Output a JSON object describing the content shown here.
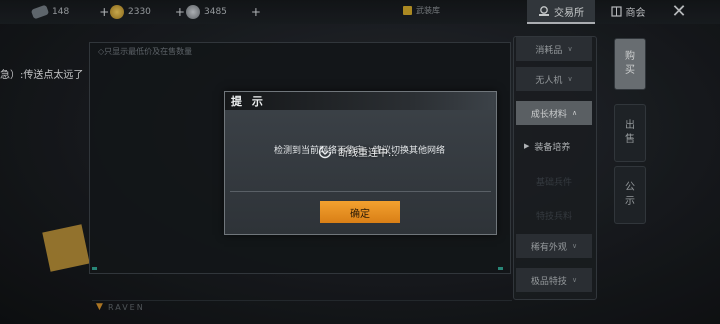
{
  "currencies": [
    {
      "icon": "fuel-icon",
      "value": "148"
    },
    {
      "icon": "gold-coin-icon",
      "value": "2330"
    },
    {
      "icon": "silver-coin-icon",
      "value": "3485"
    }
  ],
  "plus_label": "+",
  "warehouse_label": "武装库",
  "tabs": {
    "exchange": "交易所",
    "shop": "商会"
  },
  "close_glyph": "✕",
  "chat_message": "急）:传送点太远了",
  "panel_hint": "◇只显示最低价及在售数量",
  "categories": [
    {
      "label": "消耗品",
      "chevron": "∨"
    },
    {
      "label": "无人机",
      "chevron": "∨"
    },
    {
      "label": "成长材料",
      "chevron": "∧",
      "active": true
    }
  ],
  "subcategories": [
    "装备培养",
    "基础兵件",
    "特技兵料"
  ],
  "categories_bottom": [
    {
      "label": "稀有外观",
      "chevron": "∨"
    },
    {
      "label": "极品特技",
      "chevron": "∨"
    }
  ],
  "vertical_tabs": [
    "购\n买",
    "出\n售",
    "公\n示"
  ],
  "footer_brand": "RAVEN",
  "dialog": {
    "title": "提 示",
    "message": "检测到当前网络不稳定，建议切换其他网络",
    "reconnect_text": "断线重连中...",
    "confirm_label": "确定"
  },
  "colors": {
    "accent_orange": "#e8911f",
    "active_tab": "#7b8185",
    "teal_tick": "#2f9e8c"
  }
}
